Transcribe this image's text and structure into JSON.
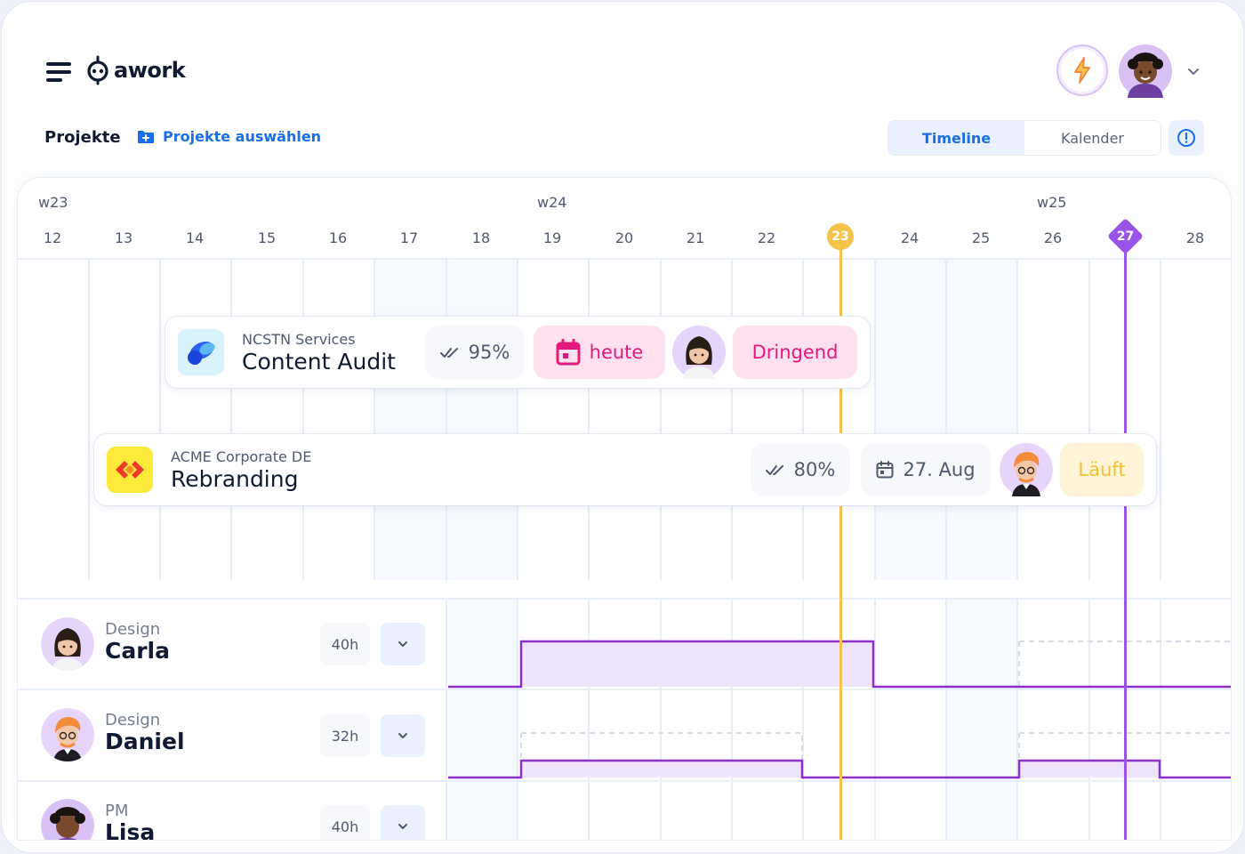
{
  "app": {
    "name": "awork"
  },
  "header": {
    "projects_label": "Projekte",
    "select_projects_label": "Projekte auswählen",
    "view_tabs": [
      {
        "label": "Timeline",
        "active": true
      },
      {
        "label": "Kalender",
        "active": false
      }
    ]
  },
  "timeline": {
    "weeks": [
      "w23",
      "w24",
      "w25"
    ],
    "days": [
      "12",
      "13",
      "14",
      "15",
      "16",
      "17",
      "18",
      "19",
      "20",
      "21",
      "22",
      "23",
      "24",
      "25",
      "26",
      "27",
      "28"
    ],
    "today": "23",
    "deadline": "27"
  },
  "projects": [
    {
      "client": "NCSTN Services",
      "name": "Content Audit",
      "progress": "95%",
      "due": "heute",
      "status": "Dringend"
    },
    {
      "client": "ACME Corporate DE",
      "name": "Rebranding",
      "progress": "80%",
      "due": "27. Aug",
      "status": "Läuft"
    }
  ],
  "people": [
    {
      "role": "Design",
      "name": "Carla",
      "hours": "40h"
    },
    {
      "role": "Design",
      "name": "Daniel",
      "hours": "32h"
    },
    {
      "role": "PM",
      "name": "Lisa",
      "hours": "40h"
    }
  ],
  "colors": {
    "accent": "#1a6fe8",
    "today": "#f4c34a",
    "deadline": "#9a55e8",
    "urgent": "#e4197e",
    "running": "#f3bf32"
  }
}
